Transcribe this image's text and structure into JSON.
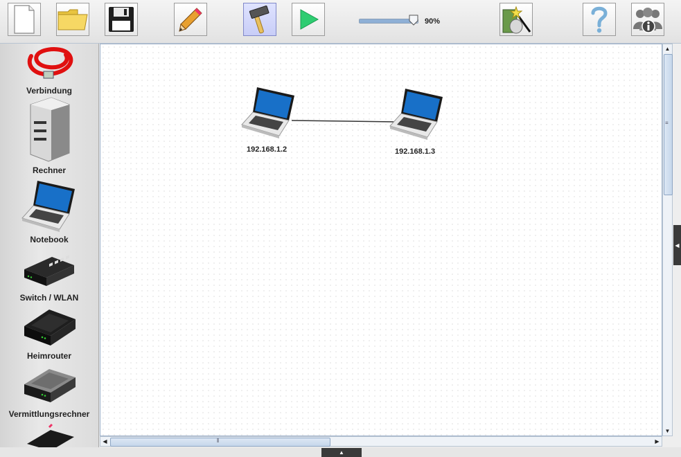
{
  "toolbar": {
    "buttons": [
      {
        "name": "new-file",
        "icon": "new-file-icon"
      },
      {
        "name": "open-folder",
        "icon": "folder-icon"
      },
      {
        "name": "save",
        "icon": "floppy-disk-icon"
      },
      {
        "name": "design-mode",
        "icon": "pencil-icon"
      },
      {
        "name": "simulation-mode",
        "icon": "hammer-icon",
        "active": true
      },
      {
        "name": "run",
        "icon": "play-icon"
      },
      {
        "name": "wizard",
        "icon": "magic-wand-icon"
      },
      {
        "name": "help",
        "icon": "question-mark-icon"
      },
      {
        "name": "about",
        "icon": "info-people-icon"
      }
    ],
    "zoom": {
      "value": 0.9,
      "label": "90%"
    }
  },
  "palette": {
    "items": [
      {
        "label": "Verbindung",
        "icon": "cable-icon"
      },
      {
        "label": "Rechner",
        "icon": "computer-tower-icon"
      },
      {
        "label": "Notebook",
        "icon": "notebook-icon"
      },
      {
        "label": "Switch / WLAN",
        "icon": "switch-icon"
      },
      {
        "label": "Heimrouter",
        "icon": "home-router-icon"
      },
      {
        "label": "Vermittlungsrechner",
        "icon": "router-icon"
      }
    ]
  },
  "canvas": {
    "nodes": [
      {
        "label": "192.168.1.2",
        "icon": "notebook-icon"
      },
      {
        "label": "192.168.1.3",
        "icon": "notebook-icon"
      }
    ]
  },
  "colors": {
    "cable": "#e01010",
    "accent": "#8fb0d6",
    "canvas_border": "#9db0c8"
  }
}
